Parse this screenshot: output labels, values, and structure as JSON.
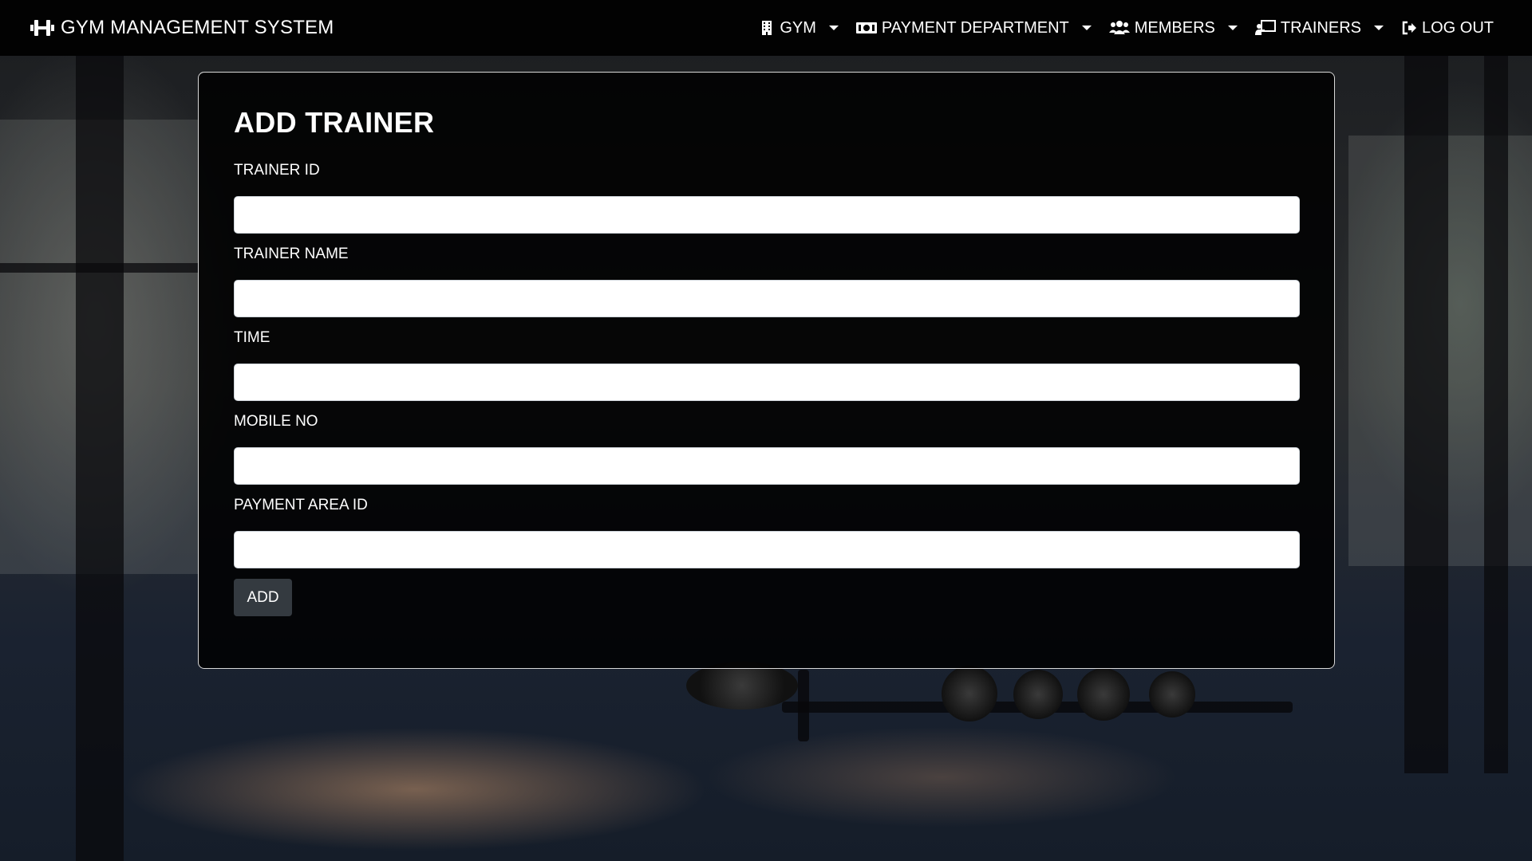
{
  "brand": {
    "title": "GYM MANAGEMENT SYSTEM",
    "icon": "dumbbell-icon"
  },
  "nav": [
    {
      "label": "GYM",
      "icon": "building-icon",
      "dropdown": true
    },
    {
      "label": "PAYMENT DEPARTMENT",
      "icon": "money-bill-icon",
      "dropdown": true
    },
    {
      "label": "MEMBERS",
      "icon": "users-icon",
      "dropdown": true
    },
    {
      "label": "TRAINERS",
      "icon": "chalkboard-teacher-icon",
      "dropdown": true
    },
    {
      "label": "LOG OUT",
      "icon": "sign-out-icon",
      "dropdown": false
    }
  ],
  "form": {
    "title": "ADD TRAINER",
    "fields": [
      {
        "label": "TRAINER ID",
        "value": ""
      },
      {
        "label": "TRAINER NAME",
        "value": ""
      },
      {
        "label": "TIME",
        "value": ""
      },
      {
        "label": "MOBILE NO",
        "value": ""
      },
      {
        "label": "PAYMENT AREA ID",
        "value": ""
      }
    ],
    "submit_label": "ADD"
  },
  "colors": {
    "navbar_bg": "#000000",
    "card_bg": "#000000",
    "button_bg": "#343a40",
    "text": "#ffffff"
  }
}
